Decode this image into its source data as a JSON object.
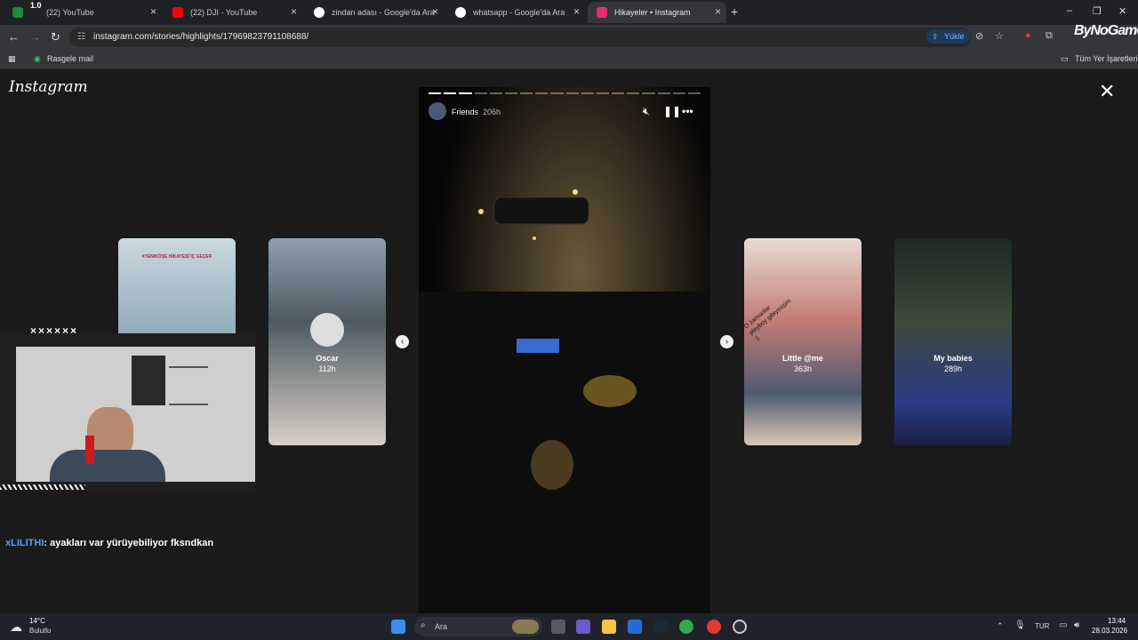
{
  "browser": {
    "tabs": [
      {
        "title": "(22) YouTube",
        "badge": "1.0"
      },
      {
        "title": "(22) DJI - YouTube"
      },
      {
        "title": "zindan adası - Google'da Ara"
      },
      {
        "title": "whatsapp - Google'da Ara"
      },
      {
        "title": "Hikayeler • Instagram"
      }
    ],
    "url": "instagram.com/stories/highlights/17969823791108688/",
    "upload_label": "Yükle",
    "extension_badge": "ByNoGame",
    "bookmark": "Rasgele mail",
    "all_bookmarks": "Tüm Yer İşaretleri"
  },
  "instagram": {
    "logo": "Instagram",
    "current_story": {
      "user": "Friends",
      "time": "206h",
      "segments_total": 18,
      "segments_done": 3
    },
    "side_stories": [
      {
        "name": "",
        "time": "",
        "overlay_text": "#YENIKÖŞE HİKAYESİ İÇ GEÇER"
      },
      {
        "name": "Oscar",
        "time": "112h"
      },
      {
        "name": "Little @me",
        "time": "363h",
        "overlay_text": "O zamanlar playboy gibiymişim :)"
      },
      {
        "name": "My babies",
        "time": "289h"
      }
    ]
  },
  "stream": {
    "webcam_marks": "××××××",
    "chat": {
      "user": "xLILITHI",
      "message": ": ayakları var yürüyebiliyor fksndkan"
    }
  },
  "taskbar": {
    "weather_temp": "14°C",
    "weather_desc": "Bulutlu",
    "search_placeholder": "Ara",
    "language": "TUR",
    "time": "13:44",
    "date": "28.03.2026"
  },
  "colors": {
    "accent": "#8ab4f8",
    "chat_user": "#4ea1ff",
    "instagram_fav": "#e1306c",
    "youtube_red": "#ff0000"
  }
}
